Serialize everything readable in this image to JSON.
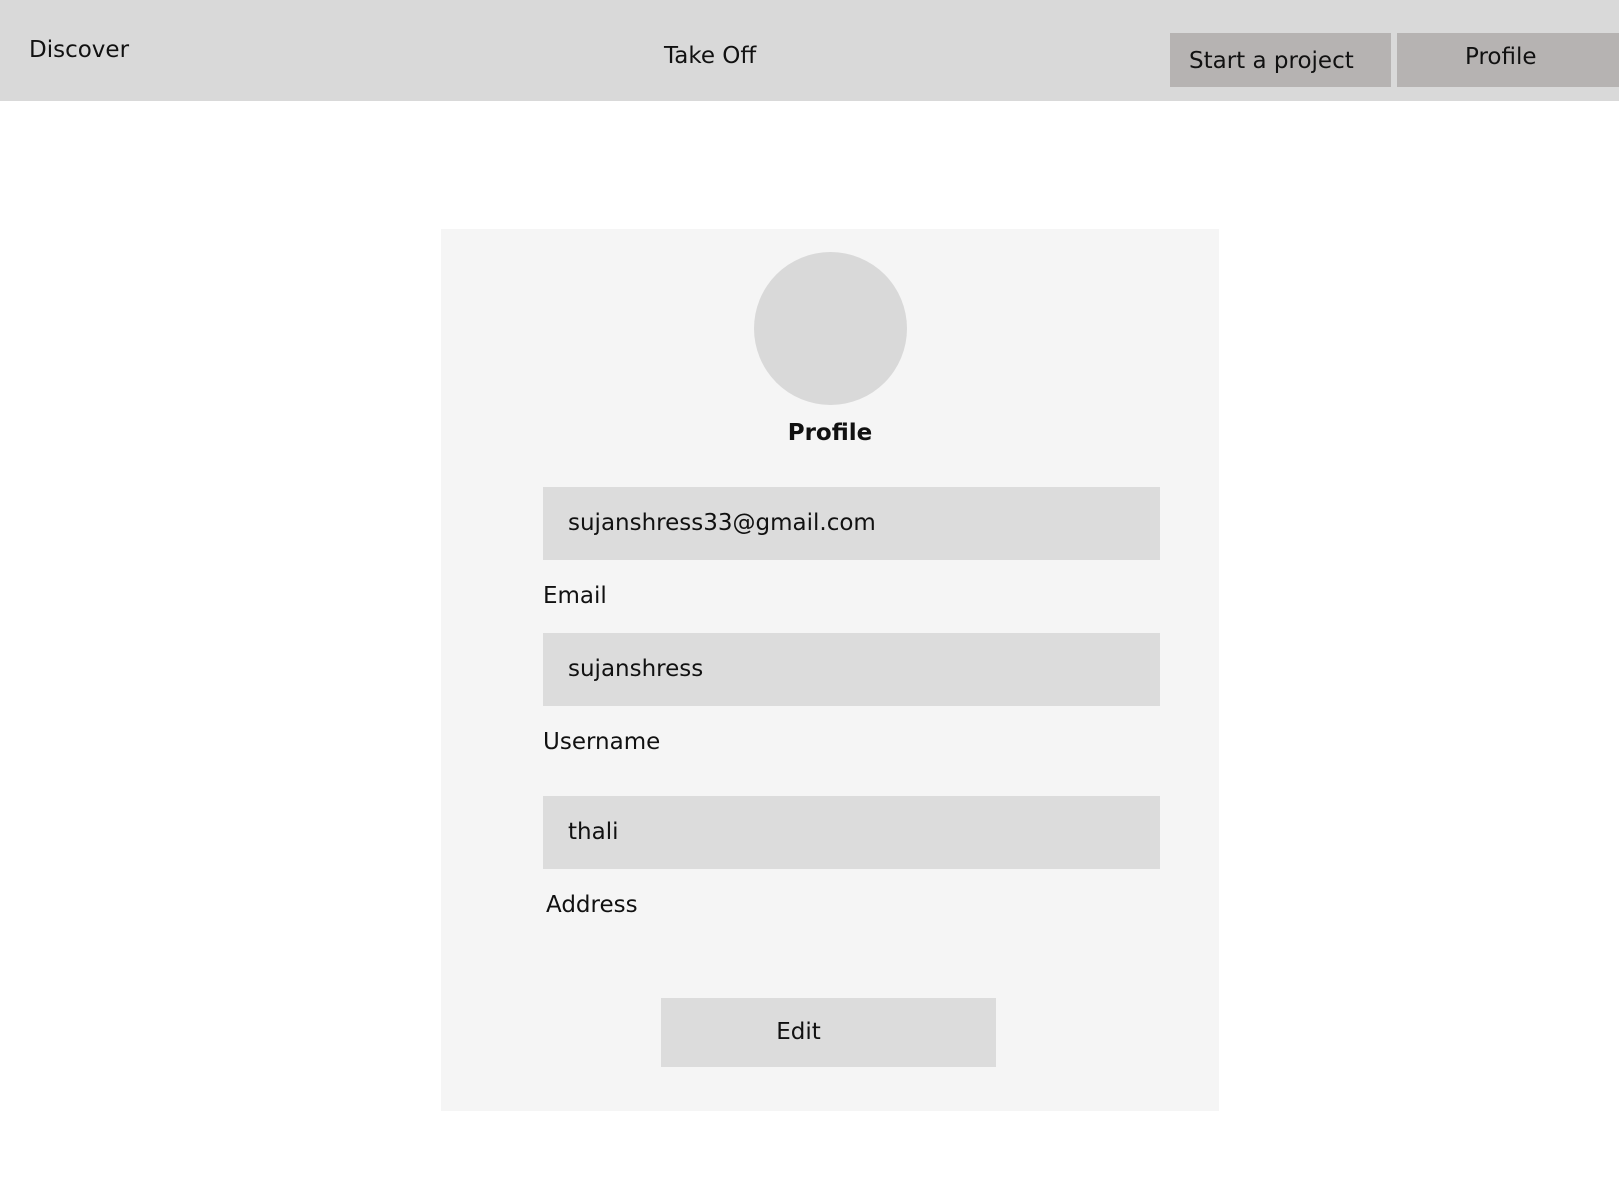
{
  "nav": {
    "discover": "Discover",
    "title": "Take Off",
    "start_project": "Start a project",
    "profile": "Profile"
  },
  "profile_card": {
    "heading": "Profile",
    "fields": [
      {
        "label": "Email",
        "value": "sujanshress33@gmail.com"
      },
      {
        "label": "Username",
        "value": "sujanshress"
      },
      {
        "label": "Address",
        "value": "thali"
      }
    ],
    "edit_label": "Edit"
  },
  "colors": {
    "topbar": "#d9d9d9",
    "nav_button": "#b6b3b2",
    "card": "#f5f5f5",
    "field": "#dcdcdc",
    "avatar": "#d9d9d9"
  }
}
